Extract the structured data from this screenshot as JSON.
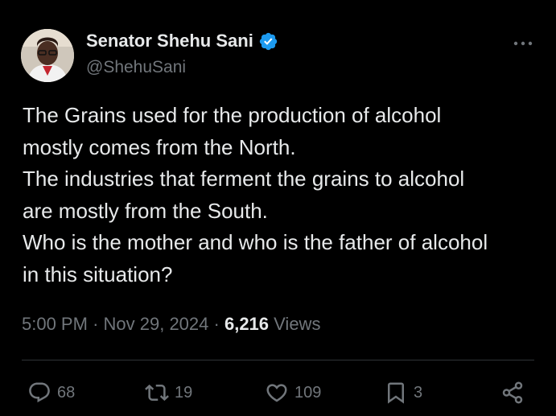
{
  "author": {
    "name": "Senator Shehu Sani",
    "handle": "@ShehuSani",
    "verified_icon": "verified-badge-icon",
    "accent": "#1d9bf0"
  },
  "tweet": {
    "lines": [
      "The Grains used for the production of alcohol",
      "mostly comes from the North.",
      "The industries that ferment the grains to alcohol",
      "are mostly from the South.",
      "Who is the mother and who is the father of alcohol",
      "in this situation?"
    ]
  },
  "meta": {
    "time": "5:00 PM",
    "sep1": "·",
    "date": "Nov 29, 2024",
    "sep2": "·",
    "views_count": "6,216",
    "views_label": "Views"
  },
  "actions": {
    "reply_count": "68",
    "retweet_count": "19",
    "like_count": "109",
    "bookmark_count": "3"
  },
  "colors": {
    "background": "#000000",
    "text": "#e7e9ea",
    "muted": "#71767b",
    "divider": "#2f3336"
  }
}
